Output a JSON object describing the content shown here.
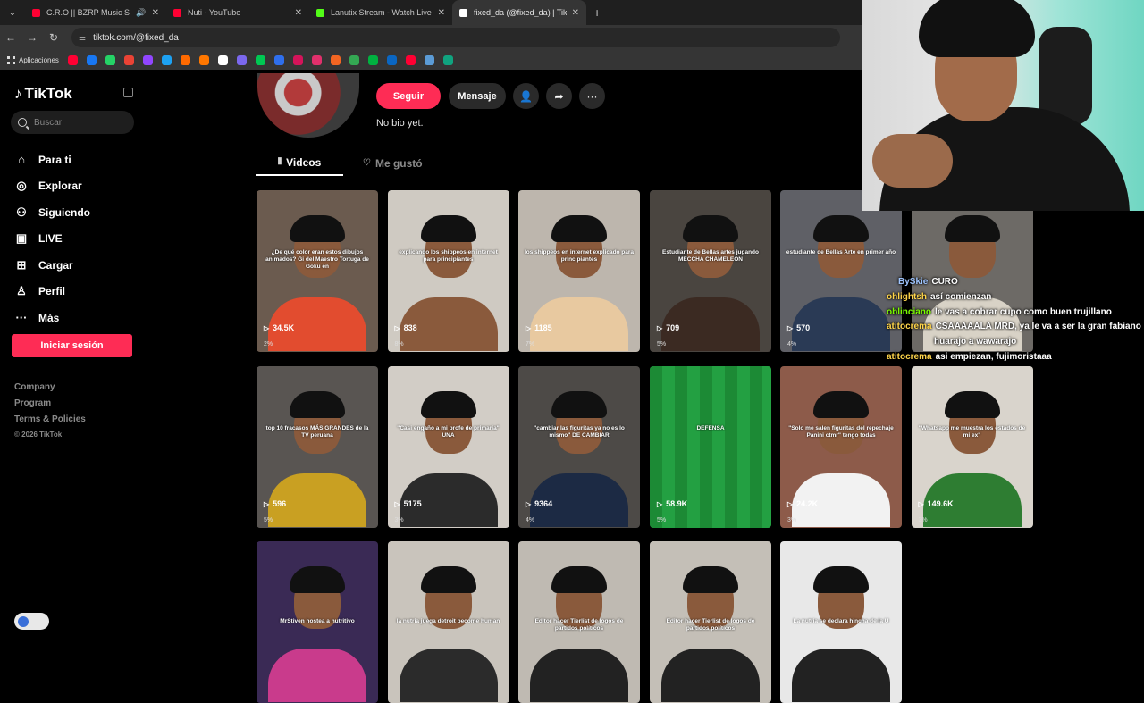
{
  "browser": {
    "tabs": [
      {
        "title": "C.R.O || BZRP Music Sessions",
        "color": "#ff0033",
        "audio": true
      },
      {
        "title": "Nuti - YouTube",
        "color": "#ff0033",
        "audio": false
      },
      {
        "title": "Lanutix Stream - Watch Live on Kick",
        "color": "#53fc18",
        "audio": false
      },
      {
        "title": "fixed_da (@fixed_da) | TikTok",
        "color": "#ffffff",
        "audio": false,
        "active": true
      }
    ],
    "url": "tiktok.com/@fixed_da",
    "apps_label": "Aplicaciones",
    "bookmark_colors": [
      "#ff0033",
      "#1877f2",
      "#25d366",
      "#ea4335",
      "#9146ff",
      "#1da1f2",
      "#ff6a00",
      "#ff7700",
      "#ffffff",
      "#7b68ee",
      "#00c853",
      "#2f6fed",
      "#d4145a",
      "#e1306c",
      "#f26522",
      "#34a853",
      "#00b140",
      "#0a66c2",
      "#ff0033",
      "#5b9bd5",
      "#10a37f"
    ]
  },
  "sidebar": {
    "logo": "TikTok",
    "search_placeholder": "Buscar",
    "items": [
      {
        "label": "Para ti",
        "icon": "home-icon",
        "glyph": "⌂"
      },
      {
        "label": "Explorar",
        "icon": "compass-icon",
        "glyph": "◎"
      },
      {
        "label": "Siguiendo",
        "icon": "following-icon",
        "glyph": "⚇"
      },
      {
        "label": "LIVE",
        "icon": "live-icon",
        "glyph": "▣"
      },
      {
        "label": "Cargar",
        "icon": "upload-icon",
        "glyph": "⊞"
      },
      {
        "label": "Perfil",
        "icon": "profile-icon",
        "glyph": "♙"
      },
      {
        "label": "Más",
        "icon": "more-icon",
        "glyph": "···"
      }
    ],
    "login_label": "Iniciar sesión",
    "footer": [
      "Company",
      "Program",
      "Terms & Policies"
    ],
    "copyright": "© 2026 TikTok"
  },
  "profile": {
    "follow_label": "Seguir",
    "message_label": "Mensaje",
    "bio": "No bio yet.",
    "tab_videos": "Videos",
    "tab_liked": "Me gustó"
  },
  "videos": [
    {
      "caption": "¿De qué color eran estos dibujos animados? Gi del Maestro Tortuga de Goku en",
      "views": "34.5K",
      "pct": "2%",
      "bg": "#6b5b4f",
      "accent": "#e24c2f"
    },
    {
      "caption": "explicando los shippeos en internet para principiantes",
      "views": "838",
      "pct": "8%",
      "bg": "#cfcac2",
      "accent": "#8a5a3c"
    },
    {
      "caption": "los shippeos en internet explicado para principiantes",
      "views": "1185",
      "pct": "7%",
      "bg": "#bdb6ad",
      "accent": "#e8c9a0"
    },
    {
      "caption": "Estudiante de Bellas artes jugando MECCHA CHAMELEON",
      "views": "709",
      "pct": "5%",
      "bg": "#4a4540",
      "accent": "#3b2a22"
    },
    {
      "caption": "estudiante de Bellas Arte en primer año",
      "views": "570",
      "pct": "4%",
      "bg": "#5f6066",
      "accent": "#2a3a55"
    },
    {
      "caption": "",
      "views": "",
      "pct": "",
      "bg": "#6d6a66",
      "accent": "#d8d2c6"
    },
    {
      "caption": "top 10 fracasos MÁS GRANDES de la TV peruana",
      "views": "596",
      "pct": "5%",
      "bg": "#595552",
      "accent": "#c9a022"
    },
    {
      "caption": "\"Casi engaño a mi profe de primaria\" UNA",
      "views": "5175",
      "pct": "3%",
      "bg": "#d2cdc6",
      "accent": "#2b2b2b"
    },
    {
      "caption": "\"cambiar las figuritas ya no es lo mismo\" DE CAMBIAR",
      "views": "9364",
      "pct": "4%",
      "bg": "#4d4a47",
      "accent": "#1c2a44"
    },
    {
      "caption": "DEFENSA",
      "views": "58.9K",
      "pct": "5%",
      "bg": "#1f8f3a",
      "accent": "#ffffff"
    },
    {
      "caption": "\"Solo me salen figuritas del repechaje Panini ctmr\" tengo todas",
      "views": "24.2K",
      "pct": "3%",
      "bg": "#8d5b4a",
      "accent": "#f2f2f2"
    },
    {
      "caption": "\"Whatsapp me muestra los estados de mi ex\"",
      "views": "149.6K",
      "pct": "3%",
      "bg": "#d9d4cc",
      "accent": "#2e7d32"
    },
    {
      "caption": "MrStiven hostea a nutritivo",
      "views": "",
      "pct": "",
      "bg": "#3a2a55",
      "accent": "#c93b8c"
    },
    {
      "caption": "la nutria juega detroit become human",
      "views": "",
      "pct": "",
      "bg": "#c9c4bc",
      "accent": "#2b2b2b"
    },
    {
      "caption": "Editor hacer Tierlist de logos de partidos políticos",
      "views": "",
      "pct": "",
      "bg": "#bfbab2",
      "accent": "#222"
    },
    {
      "caption": "Editor hacer Tierlist de logos de partidos políticos",
      "views": "",
      "pct": "",
      "bg": "#c4bfb7",
      "accent": "#222"
    },
    {
      "caption": "La nutria se declara hincha de la U",
      "views": "",
      "pct": "",
      "bg": "#e8e8e8",
      "accent": "#222"
    }
  ],
  "chat": [
    {
      "user": "BySkie",
      "user_color": "#9fc5ff",
      "text": "CURO"
    },
    {
      "user": "ohlightsh",
      "user_color": "#ffd54a",
      "text": "así comienzan"
    },
    {
      "user": "oblinciano",
      "user_color": "#7cfc00",
      "text": "le vas a cobrar cupo como buen trujillano"
    },
    {
      "user": "atitocrema",
      "user_color": "#ffd54a",
      "text": "CSAAAAALA MRD, ya le va a ser la gran fabiano"
    },
    {
      "user": "",
      "user_color": "#ffd54a",
      "text": "huarajo a wawarajo"
    },
    {
      "user": "atitocrema",
      "user_color": "#ffd54a",
      "text": "asi empiezan, fujimoristaaa"
    }
  ]
}
